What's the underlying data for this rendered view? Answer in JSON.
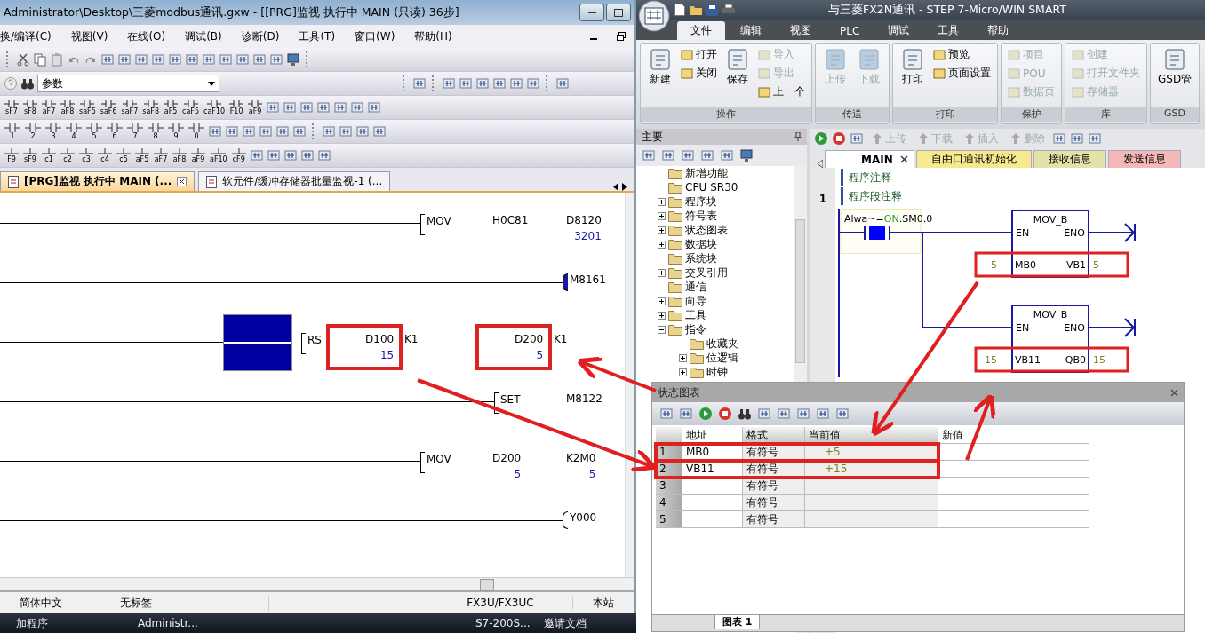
{
  "left": {
    "title": "Administrator\\Desktop\\三菱modbus通讯.gxw - [[PRG]监视 执行中 MAIN (只读) 36步]",
    "menu": [
      "换/编译(C)",
      "视图(V)",
      "在线(O)",
      "调试(B)",
      "诊断(D)",
      "工具(T)",
      "窗口(W)",
      "帮助(H)"
    ],
    "search": {
      "value": "参数"
    },
    "key_row_1": [
      "sF7",
      "sF8",
      "aF7",
      "aF8",
      "saF5",
      "saF6",
      "saF7",
      "saF8",
      "aF5",
      "caF5",
      "caF10",
      "F10",
      "aF9"
    ],
    "key_row_2": [
      "1",
      "2",
      "3",
      "4",
      "5",
      "6",
      "7",
      "8",
      "9",
      "0"
    ],
    "key_row_3": [
      "F9",
      "sF9",
      "c1",
      "c2",
      "c3",
      "c4",
      "c5",
      "aF5",
      "aF7",
      "aF8",
      "aF9",
      "aF10",
      "cF9"
    ],
    "tabs": [
      {
        "label": "[PRG]监视 执行中 MAIN (...",
        "selected": true
      },
      {
        "label": "软元件/缓冲存储器批量监视-1 (...",
        "selected": false
      }
    ],
    "rungs": [
      {
        "kind": "instruction",
        "name": "MOV",
        "operands": [
          {
            "label": "H0C81",
            "marked": false
          },
          {
            "label": "D8120",
            "value": "3201",
            "marked": false
          }
        ]
      },
      {
        "kind": "coil",
        "operand": "M8161",
        "active": true
      },
      {
        "kind": "contact_instruction",
        "contact_on": true,
        "name": "RS",
        "operands": [
          {
            "label": "D100",
            "value": "15",
            "marked": true
          },
          {
            "label": "K1",
            "marked": false
          },
          {
            "label": "D200",
            "value": "5",
            "marked": true
          },
          {
            "label": "K1",
            "marked": false
          }
        ]
      },
      {
        "kind": "instruction",
        "name": "SET",
        "operands": [
          {
            "label": "M8122",
            "marked": false
          }
        ]
      },
      {
        "kind": "instruction",
        "name": "MOV",
        "operands": [
          {
            "label": "D200",
            "value": "5",
            "marked": false
          },
          {
            "label": "K2M0",
            "value": "5",
            "marked": false
          }
        ]
      },
      {
        "kind": "coil",
        "operand": "Y000",
        "active": false
      }
    ],
    "status_bar": [
      "简体中文",
      "无标签",
      "FX3U/FX3UC",
      "本站"
    ],
    "taskbar": [
      "加程序",
      "Administr...",
      "S7-200S...",
      "邀请文档"
    ]
  },
  "right": {
    "title": "与三菱FX2N通讯 - STEP 7-Micro/WIN SMART",
    "ribbon_tabs": [
      {
        "label": "文件",
        "selected": true
      },
      {
        "label": "编辑",
        "selected": false
      },
      {
        "label": "视图",
        "selected": false
      },
      {
        "label": "PLC",
        "selected": false
      },
      {
        "label": "调试",
        "selected": false
      },
      {
        "label": "工具",
        "selected": false
      },
      {
        "label": "帮助",
        "selected": false
      }
    ],
    "ribbon_groups": [
      {
        "label": "操作",
        "items": [
          {
            "kind": "large",
            "label": "新建",
            "disabled": false
          },
          {
            "kind": "small",
            "label": "打开",
            "disabled": false
          },
          {
            "kind": "small",
            "label": "关闭",
            "disabled": false
          },
          {
            "kind": "large",
            "label": "保存",
            "disabled": false
          },
          {
            "kind": "small",
            "label": "导入",
            "disabled": true
          },
          {
            "kind": "small",
            "label": "导出",
            "disabled": true
          },
          {
            "kind": "small",
            "label": "上一个",
            "disabled": false
          }
        ]
      },
      {
        "label": "传送",
        "items": [
          {
            "kind": "large",
            "label": "上传",
            "disabled": true
          },
          {
            "kind": "large",
            "label": "下载",
            "disabled": true
          }
        ]
      },
      {
        "label": "打印",
        "items": [
          {
            "kind": "large",
            "label": "打印",
            "disabled": false
          },
          {
            "kind": "small",
            "label": "预览",
            "disabled": false
          },
          {
            "kind": "small",
            "label": "页面设置",
            "disabled": false
          }
        ]
      },
      {
        "label": "保护",
        "items": [
          {
            "kind": "small",
            "label": "项目",
            "disabled": true
          },
          {
            "kind": "small",
            "label": "POU",
            "disabled": true
          },
          {
            "kind": "small",
            "label": "数据页",
            "disabled": true
          }
        ]
      },
      {
        "label": "库",
        "items": [
          {
            "kind": "small",
            "label": "创建",
            "disabled": true
          },
          {
            "kind": "small",
            "label": "打开文件夹",
            "disabled": true
          },
          {
            "kind": "small",
            "label": "存储器",
            "disabled": true
          }
        ]
      },
      {
        "label": "GSD",
        "items": [
          {
            "kind": "large",
            "label": "GSD管",
            "disabled": false
          }
        ]
      }
    ],
    "tree_title": "主要",
    "tree": [
      {
        "label": "新增功能"
      },
      {
        "label": "CPU SR30"
      },
      {
        "label": "程序块",
        "expanded": false
      },
      {
        "label": "符号表",
        "expanded": false
      },
      {
        "label": "状态图表",
        "expanded": false
      },
      {
        "label": "数据块",
        "expanded": false
      },
      {
        "label": "系统块"
      },
      {
        "label": "交叉引用",
        "expanded": false
      },
      {
        "label": "通信"
      },
      {
        "label": "向导",
        "expanded": false
      },
      {
        "label": "工具",
        "expanded": false
      },
      {
        "label": "指令",
        "expanded": true,
        "children": [
          {
            "label": "收藏夹"
          },
          {
            "label": "位逻辑",
            "expanded": false
          },
          {
            "label": "时钟",
            "expanded": false
          }
        ]
      }
    ],
    "editor_toolbar": [
      {
        "label": "上传",
        "disabled": true
      },
      {
        "label": "下载",
        "disabled": true
      },
      {
        "label": "插入",
        "disabled": true
      },
      {
        "label": "删除",
        "disabled": true
      }
    ],
    "pou_tabs": [
      {
        "label": "MAIN",
        "selected": true,
        "color": "#ffffff"
      },
      {
        "label": "自由口通讯初始化",
        "selected": false,
        "color": "#f7ea8e"
      },
      {
        "label": "接收信息",
        "selected": false,
        "color": "#e4e2a8"
      },
      {
        "label": "发送信息",
        "selected": false,
        "color": "#f5b8b8"
      }
    ],
    "program_comment": "程序注释",
    "network": {
      "number": "1",
      "comment": "程序段注释",
      "contact": {
        "prefix": "Alwa~=",
        "state": "ON",
        "suffix": ":SM0.0",
        "on": true
      },
      "boxes": [
        {
          "title": "MOV_B",
          "en": "EN",
          "eno": "ENO",
          "in_value": "5",
          "in": "MB0",
          "out": "VB1",
          "out_value": "5",
          "marked": true
        },
        {
          "title": "MOV_B",
          "en": "EN",
          "eno": "ENO",
          "in_value": "15",
          "in": "VB11",
          "out": "QB0",
          "out_value": "15",
          "marked": true
        }
      ]
    },
    "status_chart": {
      "title": "状态图表",
      "columns": [
        "地址",
        "格式",
        "当前值",
        "新值"
      ],
      "rows": [
        {
          "index": "1",
          "address": "MB0",
          "format": "有符号",
          "value": "+5",
          "marked": true
        },
        {
          "index": "2",
          "address": "VB11",
          "format": "有符号",
          "value": "+15",
          "marked": true
        },
        {
          "index": "3",
          "address": "",
          "format": "有符号",
          "value": "",
          "marked": false
        },
        {
          "index": "4",
          "address": "",
          "format": "有符号",
          "value": "",
          "marked": false
        },
        {
          "index": "5",
          "address": "",
          "format": "有符号",
          "value": "",
          "marked": false
        }
      ],
      "sheet_tab": "图表 1"
    }
  }
}
